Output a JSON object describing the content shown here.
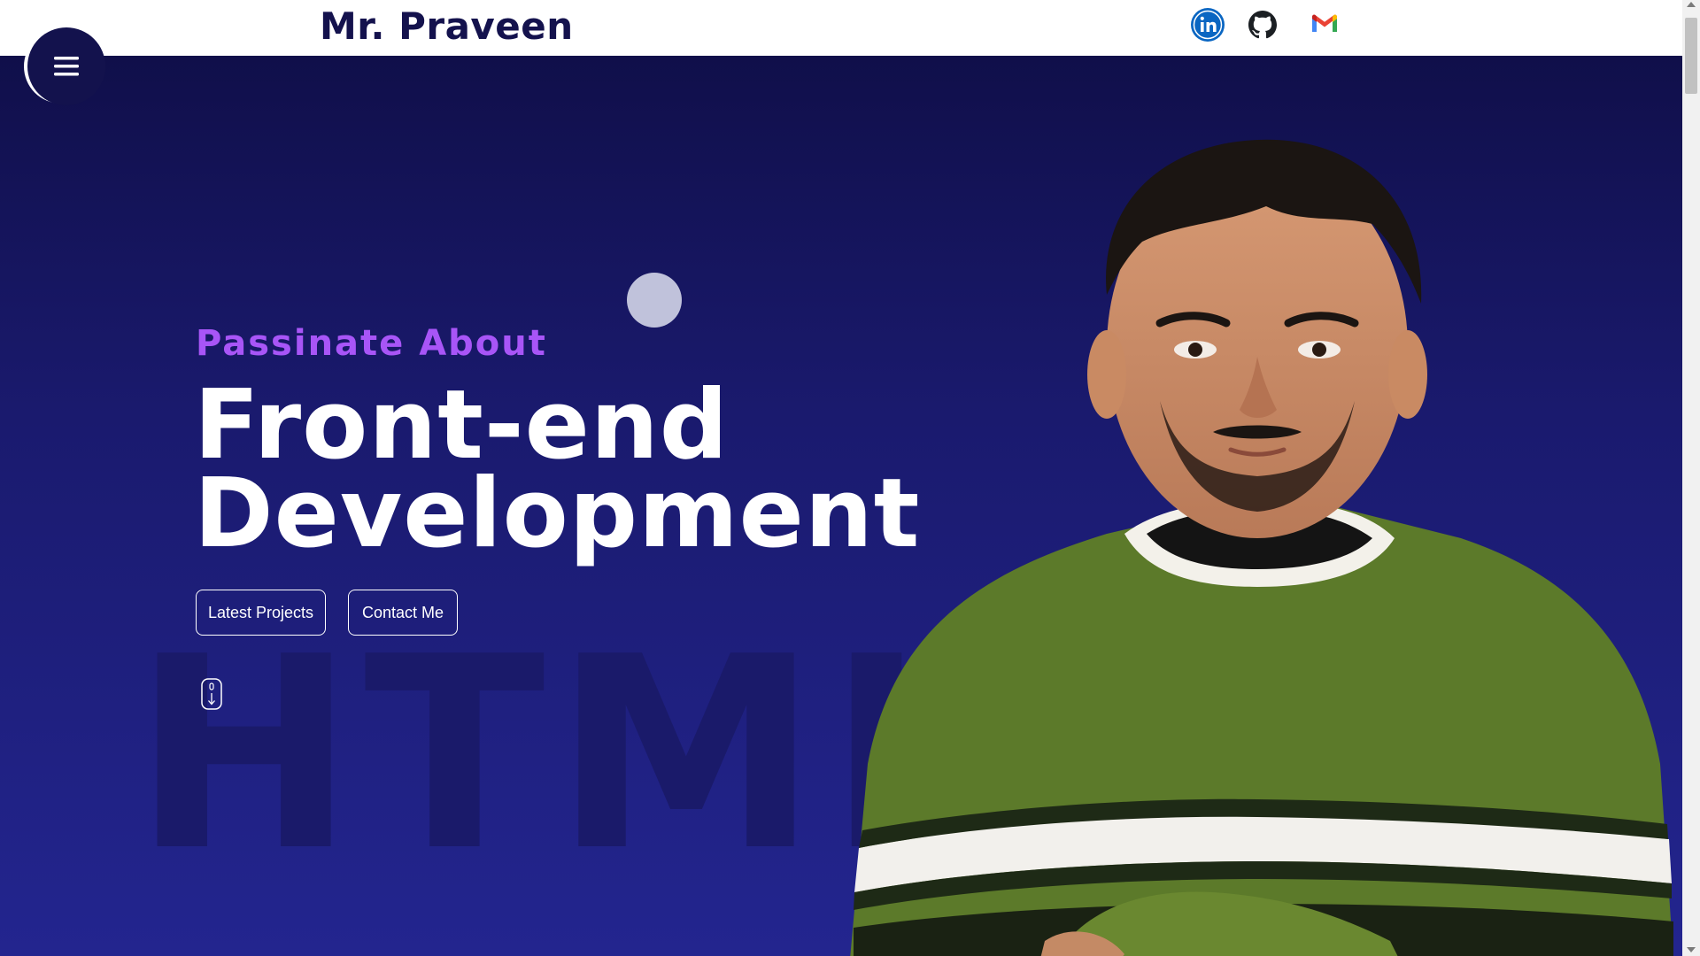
{
  "header": {
    "brand": "Mr. Praveen",
    "social": [
      {
        "name": "LinkedIn",
        "icon": "linkedin-icon"
      },
      {
        "name": "GitHub",
        "icon": "github-icon"
      },
      {
        "name": "Gmail",
        "icon": "gmail-icon"
      }
    ]
  },
  "hero": {
    "kicker": "Passinate About",
    "headline_line1": "Front-end",
    "headline_line2": "Development",
    "watermark": "HTML",
    "buttons": {
      "projects": "Latest Projects",
      "contact": "Contact Me"
    }
  },
  "icons": {
    "menu": "hamburger-menu-icon",
    "scroll": "mouse-scroll-icon"
  },
  "colors": {
    "brand_text": "#14124d",
    "hero_bg_top": "#100f4a",
    "hero_bg_bottom": "#23258f",
    "accent_purple": "#a855f7",
    "linkedin_blue": "#0a66c2"
  }
}
